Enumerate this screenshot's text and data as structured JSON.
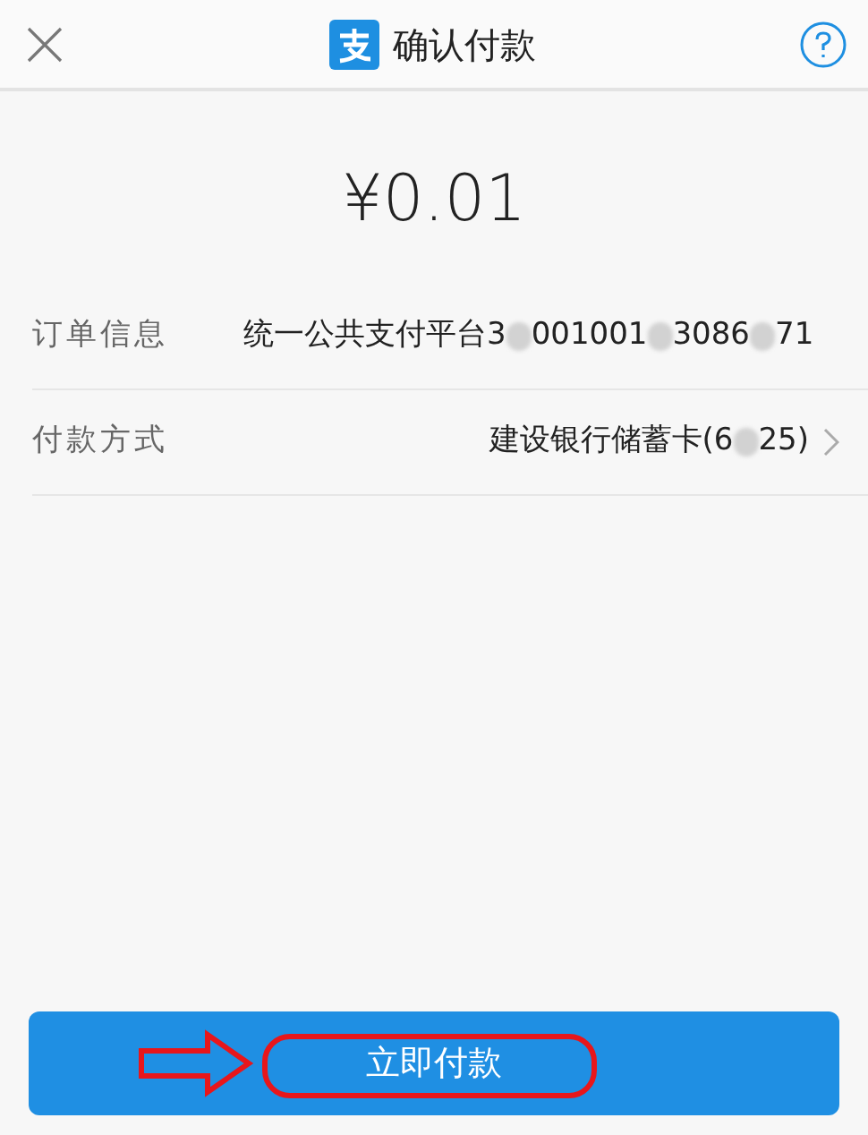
{
  "header": {
    "title": "确认付款"
  },
  "amount": "¥0.01",
  "rows": [
    {
      "label": "订单信息",
      "value_parts": [
        "统一公共支付平台3",
        "001001",
        "3086",
        "71"
      ],
      "chevron": false
    },
    {
      "label": "付款方式",
      "value_parts": [
        "建设银行储蓄卡(6",
        "25)"
      ],
      "chevron": true
    }
  ],
  "pay_button": {
    "label": "立即付款"
  },
  "annotations": {
    "arrow": true,
    "ellipse": true
  }
}
